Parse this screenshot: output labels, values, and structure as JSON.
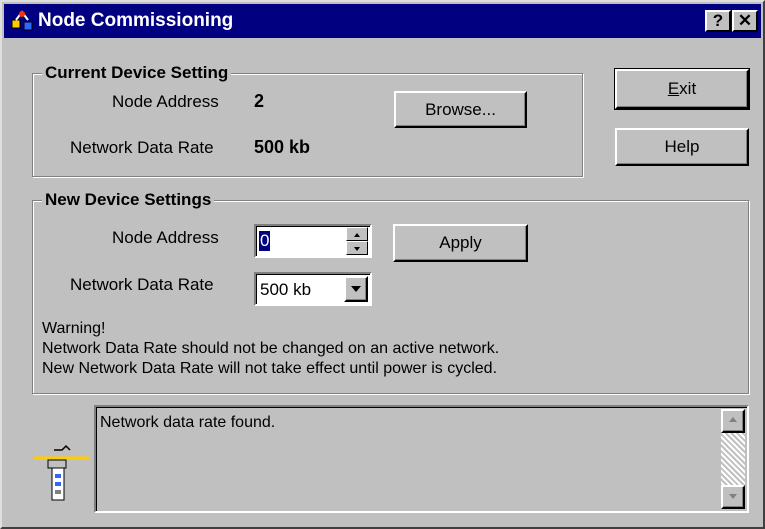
{
  "window": {
    "title": "Node Commissioning",
    "help_glyph": "?",
    "close_glyph": "✕"
  },
  "current": {
    "title": "Current Device Setting",
    "node_address_label": "Node Address",
    "node_address_value": "2",
    "data_rate_label": "Network Data Rate",
    "data_rate_value": "500 kb",
    "browse_label": "Browse..."
  },
  "buttons": {
    "exit_label": "Exit",
    "help_label": "Help"
  },
  "new": {
    "title": "New Device Settings",
    "node_address_label": "Node Address",
    "node_address_value": "0",
    "apply_label": "Apply",
    "data_rate_label": "Network Data Rate",
    "data_rate_selected": "500 kb"
  },
  "warning": {
    "line1": "Warning!",
    "line2": "Network Data Rate should not be changed on an active network.",
    "line3": "New Network Data Rate will not take effect until power is cycled."
  },
  "status": {
    "message": "Network data rate found."
  },
  "icons": {
    "title": "network-node-icon",
    "device": "device-network-icon"
  },
  "colors": {
    "titlebar": "#000080",
    "face": "#c0c0c0"
  }
}
